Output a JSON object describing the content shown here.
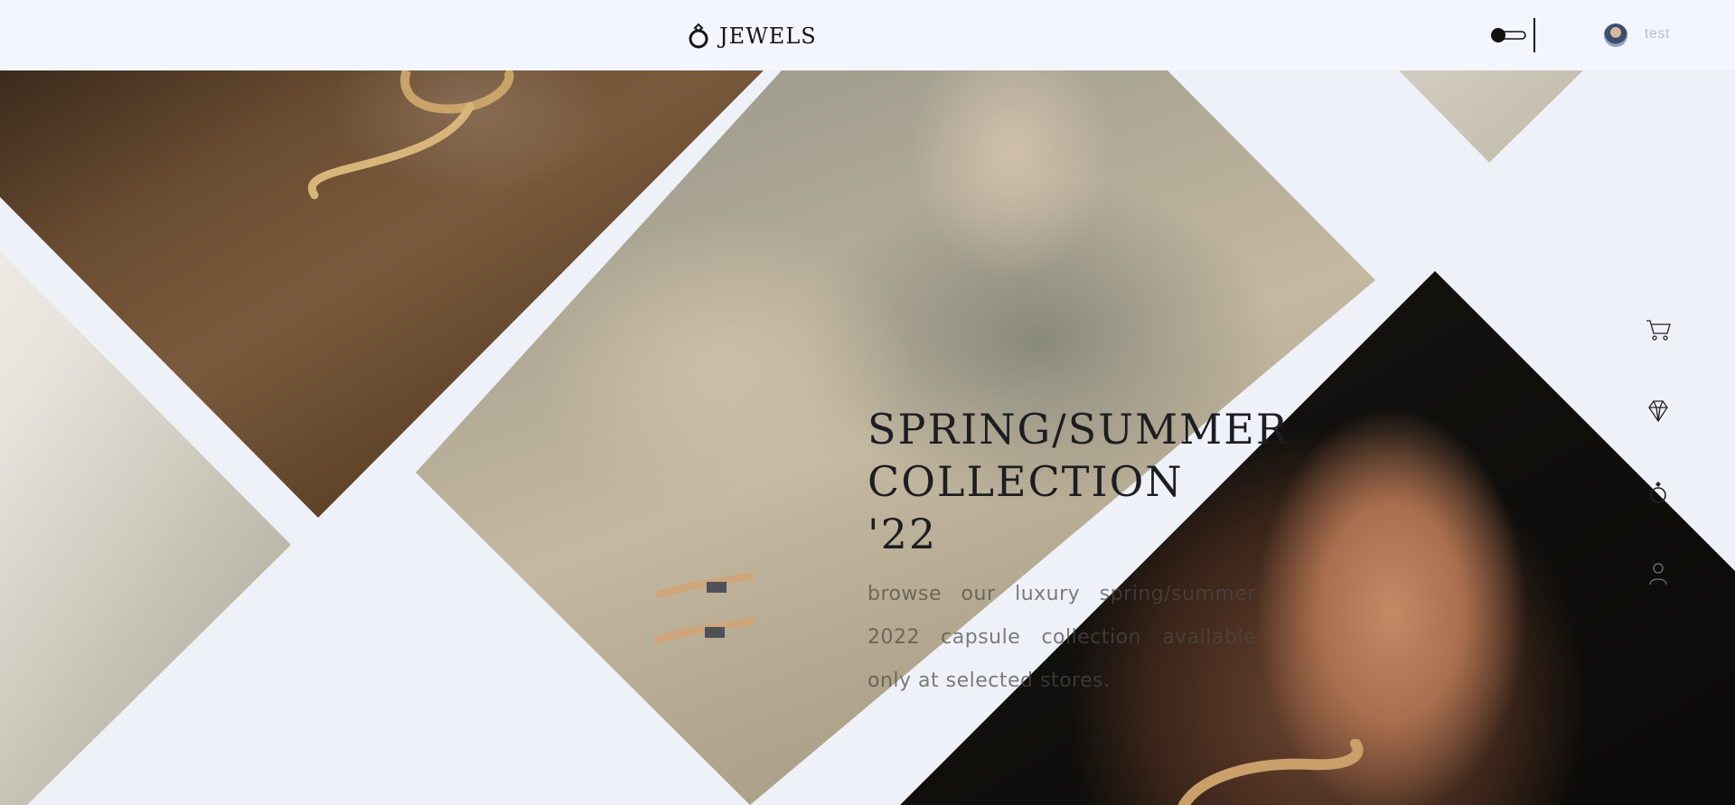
{
  "header": {
    "brand": "JEWELS",
    "username": "test"
  },
  "hero": {
    "title_line1": "SPRING/SUMMER",
    "title_line2": "COLLECTION '22",
    "description": "browse our luxury spring/summer 2022 capsule collection available only at selected stores."
  },
  "sidenav": {
    "icons": [
      "cart-icon",
      "diamond-icon",
      "ring-icon",
      "user-icon"
    ]
  },
  "colors": {
    "background": "#eef1f8",
    "header": "#f3f6fe",
    "text_dark": "#1c1e22"
  }
}
